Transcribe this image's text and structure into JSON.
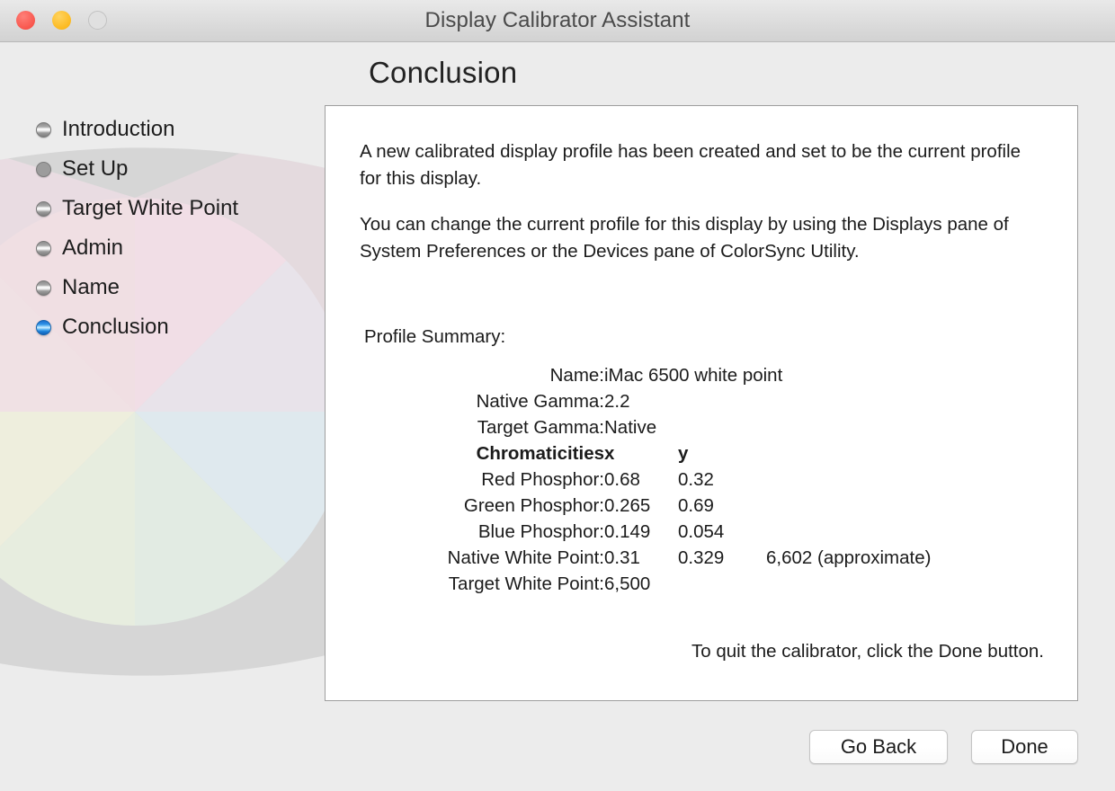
{
  "window": {
    "title": "Display Calibrator Assistant",
    "traffic_lights": [
      {
        "name": "close",
        "color": "#f8554c"
      },
      {
        "name": "minimize",
        "color": "#fcb91f"
      },
      {
        "name": "zoom",
        "color": "#e0e0e0"
      }
    ]
  },
  "page": {
    "title": "Conclusion"
  },
  "sidebar": {
    "items": [
      {
        "label": "Introduction",
        "state": "grey"
      },
      {
        "label": "Set Up",
        "state": "flat"
      },
      {
        "label": "Target White Point",
        "state": "grey"
      },
      {
        "label": "Admin",
        "state": "grey"
      },
      {
        "label": "Name",
        "state": "grey"
      },
      {
        "label": "Conclusion",
        "state": "blue"
      }
    ]
  },
  "panel": {
    "paragraph1": "A new calibrated display profile has been created and set to be the current profile for this display.",
    "paragraph2": "You can change the current profile for this display by using the Displays pane of System Preferences or the Devices pane of ColorSync Utility.",
    "summary_heading": "Profile Summary:",
    "summary_rows": [
      {
        "label": "Name:",
        "x": "iMac 6500 white point",
        "y": "",
        "extra": ""
      },
      {
        "label": "Native Gamma:",
        "x": "2.2",
        "y": "",
        "extra": ""
      },
      {
        "label": "Target Gamma:",
        "x": "Native",
        "y": "",
        "extra": ""
      },
      {
        "label": "Chromaticities",
        "x": "x",
        "y": "y",
        "extra": "",
        "bold": true,
        "header": true
      },
      {
        "label": "Red Phosphor:",
        "x": "0.68",
        "y": "0.32",
        "extra": ""
      },
      {
        "label": "Green Phosphor:",
        "x": "0.265",
        "y": "0.69",
        "extra": ""
      },
      {
        "label": "Blue Phosphor:",
        "x": "0.149",
        "y": "0.054",
        "extra": ""
      },
      {
        "label": "Native White Point:",
        "x": "0.31",
        "y": "0.329",
        "extra": "6,602 (approximate)"
      },
      {
        "label": "Target White Point:",
        "x": "6,500",
        "y": "",
        "extra": ""
      }
    ],
    "quit_note": "To quit the calibrator, click the Done button."
  },
  "footer": {
    "go_back_label": "Go Back",
    "done_label": "Done"
  },
  "colors": {
    "window_background": "#ececec",
    "panel_background": "#ffffff",
    "lens_grey": "#d6d6d6",
    "accent_blue": "#2f93e6",
    "wheel": {
      "magenta": "#f0dde6",
      "pink": "#f2e0e6",
      "red": "#f1e2dc",
      "orange": "#f2ece0",
      "yellow": "#eeeedd",
      "green": "#e4ecdf",
      "cyan": "#dfeaef",
      "blue": "#e0e9f1"
    }
  }
}
